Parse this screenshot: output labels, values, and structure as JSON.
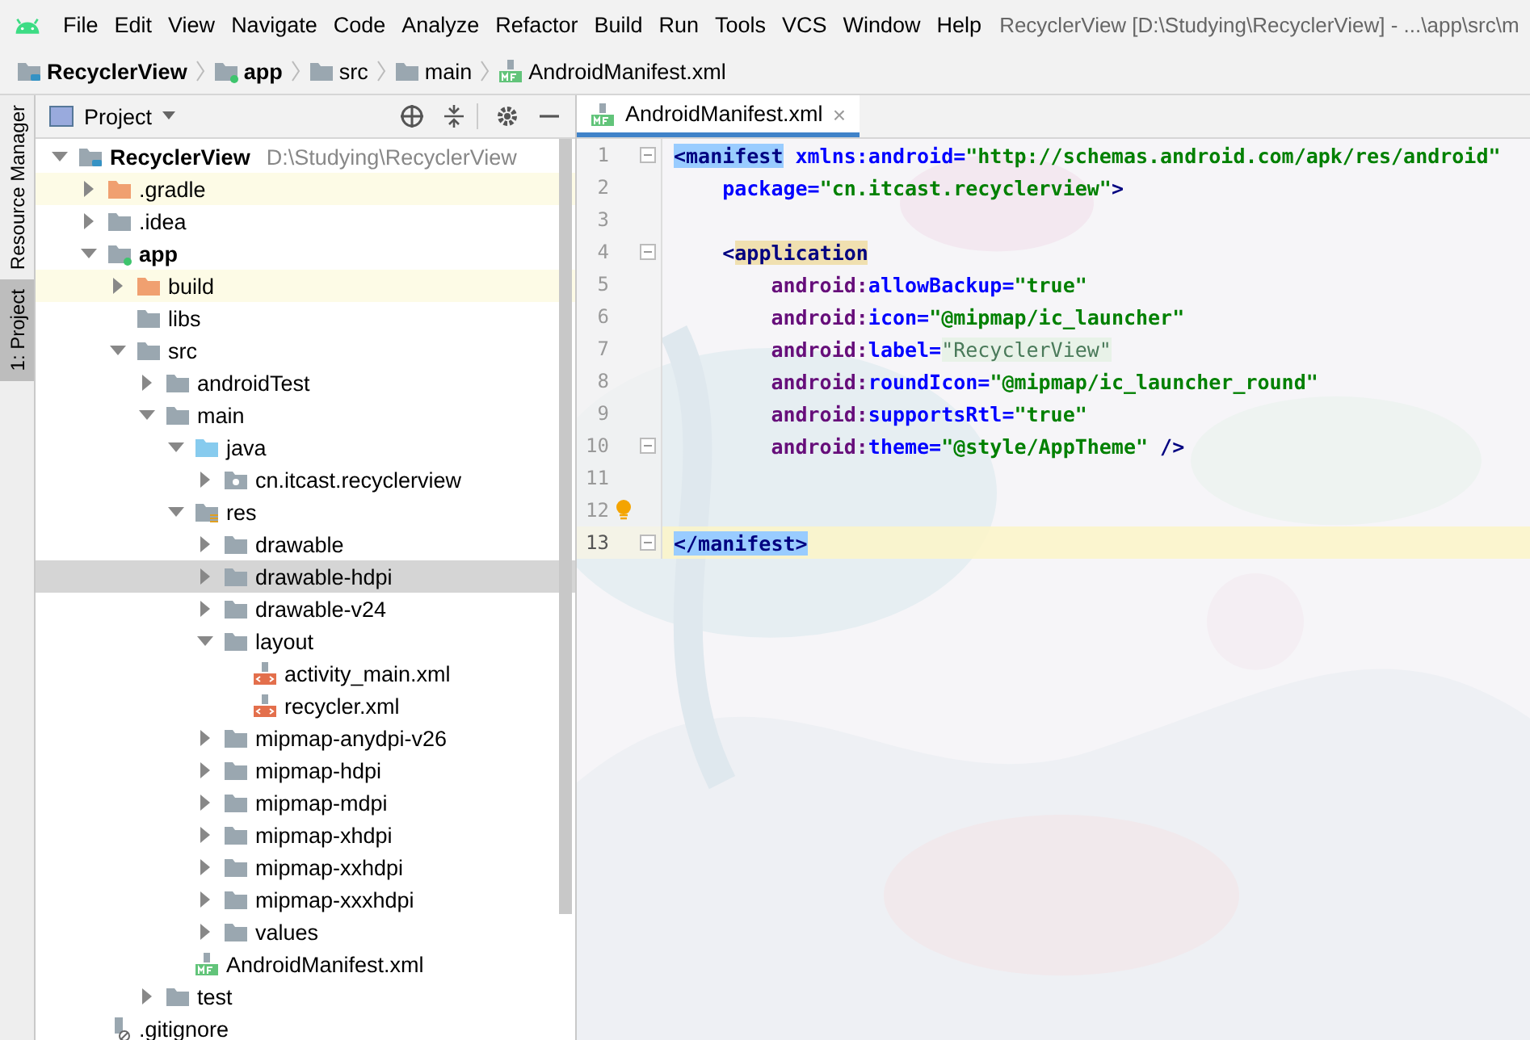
{
  "menu_bar": {
    "items": [
      "File",
      "Edit",
      "View",
      "Navigate",
      "Code",
      "Analyze",
      "Refactor",
      "Build",
      "Run",
      "Tools",
      "VCS",
      "Window",
      "Help"
    ],
    "title": "RecyclerView [D:\\Studying\\RecyclerView] - ...\\app\\src\\m"
  },
  "breadcrumbs": [
    {
      "label": "RecyclerView",
      "kind": "project"
    },
    {
      "label": "app",
      "kind": "module"
    },
    {
      "label": "src",
      "kind": "folder"
    },
    {
      "label": "main",
      "kind": "folder"
    },
    {
      "label": "AndroidManifest.xml",
      "kind": "manifest"
    }
  ],
  "tool_strip": [
    {
      "label": "Resource Manager",
      "selected": false
    },
    {
      "label": "1: Project",
      "selected": true
    }
  ],
  "project_panel": {
    "title": "Project"
  },
  "project_tree": [
    {
      "label": "RecyclerView",
      "hint": "D:\\Studying\\RecyclerView",
      "kind": "project",
      "expanded": true,
      "selected": false,
      "children": [
        {
          "label": ".gradle",
          "kind": "folder-excluded",
          "expanded": false,
          "selected": false
        },
        {
          "label": ".idea",
          "kind": "folder",
          "expanded": false,
          "selected": false
        },
        {
          "label": "app",
          "kind": "module",
          "expanded": true,
          "selected": false,
          "children": [
            {
              "label": "build",
              "kind": "folder-excluded",
              "expanded": false,
              "selected": false
            },
            {
              "label": "libs",
              "kind": "folder",
              "selected": false
            },
            {
              "label": "src",
              "kind": "folder",
              "expanded": true,
              "selected": false,
              "children": [
                {
                  "label": "androidTest",
                  "kind": "folder",
                  "expanded": false,
                  "selected": false
                },
                {
                  "label": "main",
                  "kind": "folder",
                  "expanded": true,
                  "selected": false,
                  "children": [
                    {
                      "label": "java",
                      "kind": "source-folder",
                      "expanded": true,
                      "selected": false,
                      "children": [
                        {
                          "label": "cn.itcast.recyclerview",
                          "kind": "package",
                          "expanded": false,
                          "selected": false
                        }
                      ]
                    },
                    {
                      "label": "res",
                      "kind": "res-folder",
                      "expanded": true,
                      "selected": false,
                      "children": [
                        {
                          "label": "drawable",
                          "kind": "folder",
                          "expanded": false,
                          "selected": false
                        },
                        {
                          "label": "drawable-hdpi",
                          "kind": "folder",
                          "expanded": false,
                          "selected": true
                        },
                        {
                          "label": "drawable-v24",
                          "kind": "folder",
                          "expanded": false,
                          "selected": false
                        },
                        {
                          "label": "layout",
                          "kind": "folder",
                          "expanded": true,
                          "selected": false,
                          "children": [
                            {
                              "label": "activity_main.xml",
                              "kind": "layout-xml",
                              "selected": false
                            },
                            {
                              "label": "recycler.xml",
                              "kind": "layout-xml",
                              "selected": false
                            }
                          ]
                        },
                        {
                          "label": "mipmap-anydpi-v26",
                          "kind": "folder",
                          "expanded": false,
                          "selected": false
                        },
                        {
                          "label": "mipmap-hdpi",
                          "kind": "folder",
                          "expanded": false,
                          "selected": false
                        },
                        {
                          "label": "mipmap-mdpi",
                          "kind": "folder",
                          "expanded": false,
                          "selected": false
                        },
                        {
                          "label": "mipmap-xhdpi",
                          "kind": "folder",
                          "expanded": false,
                          "selected": false
                        },
                        {
                          "label": "mipmap-xxhdpi",
                          "kind": "folder",
                          "expanded": false,
                          "selected": false
                        },
                        {
                          "label": "mipmap-xxxhdpi",
                          "kind": "folder",
                          "expanded": false,
                          "selected": false
                        },
                        {
                          "label": "values",
                          "kind": "folder",
                          "expanded": false,
                          "selected": false
                        }
                      ]
                    },
                    {
                      "label": "AndroidManifest.xml",
                      "kind": "manifest",
                      "selected": false
                    }
                  ]
                },
                {
                  "label": "test",
                  "kind": "folder",
                  "expanded": false,
                  "selected": false
                }
              ]
            }
          ]
        },
        {
          "label": ".gitignore",
          "kind": "gitignore",
          "selected": false
        }
      ]
    }
  ],
  "editor_tabs": [
    {
      "label": "AndroidManifest.xml",
      "close": "×",
      "selected": true
    }
  ],
  "code_lines": [
    {
      "number": "1",
      "fold": true,
      "current": false,
      "bulb": false,
      "segments": [
        {
          "kind": "tag-match",
          "text": "<manifest"
        },
        {
          "kind": "attr",
          "text": " xmlns:android="
        },
        {
          "kind": "val",
          "text": "\"http://schemas.android.com/apk/res/android\""
        }
      ]
    },
    {
      "number": "2",
      "fold": false,
      "current": false,
      "bulb": false,
      "segments": [
        {
          "kind": "attr",
          "text": "    package="
        },
        {
          "kind": "val",
          "text": "\"cn.itcast.recyclerview\""
        },
        {
          "kind": "tag",
          "text": ">"
        }
      ]
    },
    {
      "number": "3",
      "fold": false,
      "current": false,
      "bulb": false
    },
    {
      "number": "4",
      "fold": true,
      "current": false,
      "bulb": false,
      "segments": [
        {
          "kind": "tag",
          "text": "    <"
        },
        {
          "kind": "tag-ident",
          "text": "application"
        }
      ]
    },
    {
      "number": "5",
      "fold": false,
      "current": false,
      "bulb": false,
      "segments": [
        {
          "kind": "ns",
          "text": "        android:"
        },
        {
          "kind": "attr",
          "text": "allowBackup="
        },
        {
          "kind": "val",
          "text": "\"true\""
        }
      ]
    },
    {
      "number": "6",
      "fold": false,
      "current": false,
      "bulb": false,
      "segments": [
        {
          "kind": "ns",
          "text": "        android:"
        },
        {
          "kind": "attr",
          "text": "icon="
        },
        {
          "kind": "val",
          "text": "\"@mipmap/ic_launcher\""
        }
      ]
    },
    {
      "number": "7",
      "fold": false,
      "current": false,
      "bulb": false,
      "segments": [
        {
          "kind": "ns",
          "text": "        android:"
        },
        {
          "kind": "attr",
          "text": "label="
        },
        {
          "kind": "val-dim",
          "text": "\"RecyclerView\""
        }
      ]
    },
    {
      "number": "8",
      "fold": false,
      "current": false,
      "bulb": false,
      "segments": [
        {
          "kind": "ns",
          "text": "        android:"
        },
        {
          "kind": "attr",
          "text": "roundIcon="
        },
        {
          "kind": "val",
          "text": "\"@mipmap/ic_launcher_round\""
        }
      ]
    },
    {
      "number": "9",
      "fold": false,
      "current": false,
      "bulb": false,
      "segments": [
        {
          "kind": "ns",
          "text": "        android:"
        },
        {
          "kind": "attr",
          "text": "supportsRtl="
        },
        {
          "kind": "val",
          "text": "\"true\""
        }
      ]
    },
    {
      "number": "10",
      "fold": true,
      "current": false,
      "bulb": false,
      "segments": [
        {
          "kind": "ns",
          "text": "        android:"
        },
        {
          "kind": "attr",
          "text": "theme="
        },
        {
          "kind": "val",
          "text": "\"@style/AppTheme\""
        },
        {
          "kind": "tag",
          "text": " />"
        }
      ]
    },
    {
      "number": "11",
      "fold": false,
      "current": false,
      "bulb": false
    },
    {
      "number": "12",
      "fold": false,
      "current": false,
      "bulb": true
    },
    {
      "number": "13",
      "fold": true,
      "current": true,
      "bulb": false,
      "segments": [
        {
          "kind": "tag-match",
          "text": "</manifest>"
        }
      ]
    }
  ]
}
